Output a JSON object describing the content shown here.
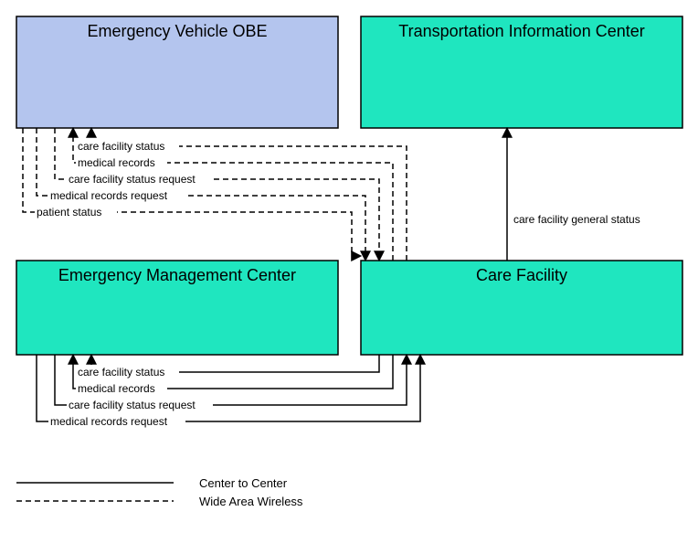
{
  "nodes": {
    "ev_obe": {
      "label": "Emergency Vehicle OBE"
    },
    "tic": {
      "label": "Transportation Information Center"
    },
    "emc": {
      "label": "Emergency Management Center"
    },
    "cf": {
      "label": "Care Facility"
    }
  },
  "flows_top": [
    {
      "label": "care facility status"
    },
    {
      "label": "medical records"
    },
    {
      "label": "care facility status request"
    },
    {
      "label": "medical records request"
    },
    {
      "label": "patient status"
    }
  ],
  "flow_cf_tic": {
    "label": "care facility general status"
  },
  "flows_bottom": [
    {
      "label": "care facility status"
    },
    {
      "label": "medical records"
    },
    {
      "label": "care facility status request"
    },
    {
      "label": "medical records request"
    }
  ],
  "legend": {
    "solid": "Center to Center",
    "dashed": "Wide Area Wireless"
  },
  "colors": {
    "ev_obe_fill": "#b4c5ee",
    "teal_fill": "#1fe6bf",
    "stroke": "#000000"
  }
}
